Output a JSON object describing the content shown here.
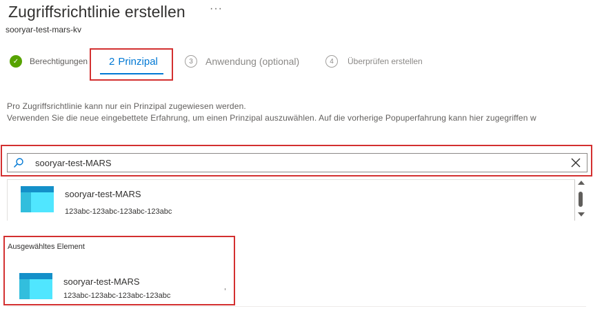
{
  "header": {
    "title": "Zugriffsrichtlinie erstellen",
    "more_label": "···",
    "subtitle": "sooryar-test-mars-kv"
  },
  "steps": [
    {
      "number": "✓",
      "label": "Berechtigungen",
      "state": "completed"
    },
    {
      "number": "2",
      "label": "Prinzipal",
      "state": "active"
    },
    {
      "number": "3",
      "label": "Anwendung (optional)",
      "state": "pending"
    },
    {
      "number": "4",
      "label": "Überprüfen erstellen",
      "state": "pending"
    }
  ],
  "info": {
    "line1": "Pro Zugriffsrichtlinie kann nur ein Prinzipal zugewiesen werden.",
    "line2": "Verwenden Sie die neue eingebettete Erfahrung, um einen Prinzipal auszuwählen. Auf die vorherige Popuperfahrung kann hier zugegriffen w"
  },
  "search": {
    "value": "sooryar-test-MARS",
    "icon": "search-icon",
    "clear_icon": "close-icon"
  },
  "results": [
    {
      "name": "sooryar-test-MARS",
      "id": "123abc-123abc-123abc-123abc",
      "icon": "app-registration-icon"
    }
  ],
  "selected": {
    "label": "Ausgewähltes Element",
    "item": {
      "name": "sooryar-test-MARS",
      "id": "123abc-123abc-123abc-123abc",
      "icon": "app-registration-icon"
    }
  },
  "colors": {
    "accent": "#0078d4",
    "success": "#57a300",
    "highlight": "#d32f2f",
    "app_icon_dark": "#1490c9",
    "app_icon_light": "#50e6ff"
  }
}
